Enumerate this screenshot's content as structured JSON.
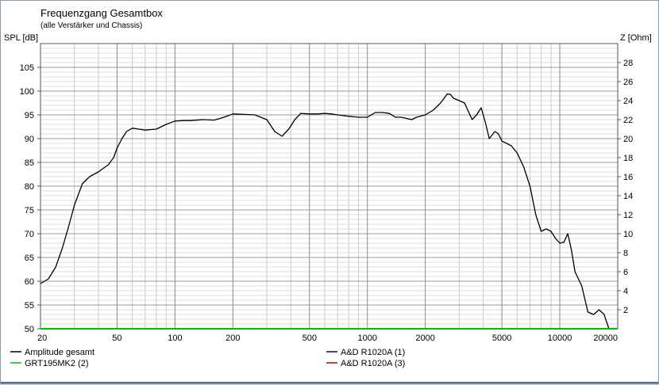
{
  "chart_data": {
    "type": "line",
    "title": "Frequenzgang Gesamtbox",
    "subtitle": "(alle Verstärker und Chassis)",
    "ylabel": "SPL [dB]",
    "y2label": "Z [Ohm]",
    "x_scale": "log",
    "xlim": [
      20,
      20000
    ],
    "ylim": [
      50,
      110
    ],
    "y2lim": [
      0,
      30
    ],
    "grid": true,
    "x_ticks": [
      {
        "value": 20,
        "label": "20"
      },
      {
        "value": 50,
        "label": "50"
      },
      {
        "value": 100,
        "label": "100"
      },
      {
        "value": 200,
        "label": "200"
      },
      {
        "value": 500,
        "label": "500"
      },
      {
        "value": 1000,
        "label": "1000"
      },
      {
        "value": 2000,
        "label": "2000"
      },
      {
        "value": 5000,
        "label": "5000"
      },
      {
        "value": 10000,
        "label": "10000"
      },
      {
        "value": 20000,
        "label": "20000"
      }
    ],
    "y_ticks": [
      {
        "value": 50,
        "label": "50"
      },
      {
        "value": 55,
        "label": "55"
      },
      {
        "value": 60,
        "label": "60"
      },
      {
        "value": 65,
        "label": "65"
      },
      {
        "value": 70,
        "label": "70"
      },
      {
        "value": 75,
        "label": "75"
      },
      {
        "value": 80,
        "label": "80"
      },
      {
        "value": 85,
        "label": "85"
      },
      {
        "value": 90,
        "label": "90"
      },
      {
        "value": 95,
        "label": "95"
      },
      {
        "value": 100,
        "label": "100"
      },
      {
        "value": 105,
        "label": "105"
      }
    ],
    "y2_ticks": [
      {
        "value": 2,
        "label": "2"
      },
      {
        "value": 4,
        "label": "4"
      },
      {
        "value": 6,
        "label": "6"
      },
      {
        "value": 8,
        "label": "8"
      },
      {
        "value": 10,
        "label": "10"
      },
      {
        "value": 12,
        "label": "12"
      },
      {
        "value": 14,
        "label": "14"
      },
      {
        "value": 16,
        "label": "16"
      },
      {
        "value": 18,
        "label": "18"
      },
      {
        "value": 20,
        "label": "20"
      },
      {
        "value": 22,
        "label": "22"
      },
      {
        "value": 24,
        "label": "24"
      },
      {
        "value": 26,
        "label": "26"
      },
      {
        "value": 28,
        "label": "28"
      }
    ],
    "series": [
      {
        "name": "Amplitude gesamt",
        "color": "#000000",
        "x": [
          20,
          22,
          24,
          26,
          28,
          30,
          33,
          36,
          40,
          45,
          48,
          50,
          53,
          56,
          60,
          65,
          70,
          80,
          90,
          100,
          110,
          120,
          140,
          160,
          180,
          200,
          230,
          260,
          300,
          330,
          360,
          390,
          420,
          450,
          500,
          550,
          600,
          650,
          700,
          800,
          900,
          1000,
          1100,
          1200,
          1300,
          1400,
          1500,
          1700,
          1800,
          2000,
          2200,
          2400,
          2600,
          2700,
          2800,
          3000,
          3200,
          3500,
          3700,
          3900,
          4100,
          4300,
          4600,
          4800,
          5000,
          5300,
          5600,
          6000,
          6500,
          7000,
          7500,
          8000,
          8500,
          9000,
          9500,
          10000,
          10500,
          11000,
          11500,
          12000,
          13000,
          14000,
          15000,
          16000,
          17000,
          18000
        ],
        "values": [
          59.5,
          60.5,
          63,
          67,
          71.5,
          76,
          80.5,
          82,
          83,
          84.5,
          86,
          88,
          90,
          91.5,
          92.2,
          92,
          91.8,
          92,
          93,
          93.7,
          93.8,
          93.8,
          94,
          93.9,
          94.5,
          95.2,
          95.1,
          95,
          94,
          91.5,
          90.5,
          92,
          94,
          95.3,
          95.2,
          95.2,
          95.3,
          95.2,
          95,
          94.7,
          94.5,
          94.5,
          95.5,
          95.5,
          95.3,
          94.5,
          94.5,
          94,
          94.5,
          95,
          96,
          97.5,
          99.4,
          99.3,
          98.5,
          98,
          97.5,
          94,
          95,
          96.5,
          93.5,
          90,
          91.5,
          91,
          89.5,
          89,
          88.5,
          87,
          84,
          80,
          74,
          70.5,
          71,
          70.5,
          69,
          68,
          68.2,
          70,
          66.5,
          62,
          59,
          53.5,
          53,
          54,
          53,
          50
        ]
      },
      {
        "name": "GRT195MK2 (2)",
        "color": "#00c000",
        "x": [
          20,
          20000
        ],
        "values": [
          50,
          50
        ]
      },
      {
        "name": "A&D R1020A (1)",
        "color": "#00008b",
        "x": [],
        "values": []
      },
      {
        "name": "A&D R1020A (3)",
        "color": "#c00000",
        "x": [],
        "values": []
      }
    ]
  }
}
